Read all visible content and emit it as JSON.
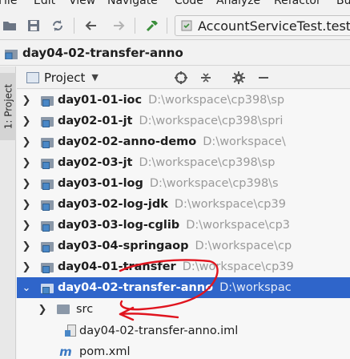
{
  "menu": {
    "items": [
      "File",
      "Edit",
      "View",
      "Navigate",
      "Code",
      "Analyze",
      "Refactor",
      "Build"
    ]
  },
  "toolbar": {
    "run_config": "AccountServiceTest.testTr"
  },
  "navbar": {
    "title": "day04-02-transfer-anno"
  },
  "toolstrip": {
    "label": "1: Project"
  },
  "panel": {
    "title": "Project"
  },
  "tree": {
    "rows": [
      {
        "name": "day01-01-ioc",
        "path": "D:\\workspace\\cp398\\sp"
      },
      {
        "name": "day02-01-jt",
        "path": "D:\\workspace\\cp398\\spri"
      },
      {
        "name": "day02-02-anno-demo",
        "path": "D:\\workspace\\"
      },
      {
        "name": "day02-03-jt",
        "path": "D:\\workspace\\cp398\\sp"
      },
      {
        "name": "day03-01-log",
        "path": "D:\\workspace\\cp398\\s"
      },
      {
        "name": "day03-02-log-jdk",
        "path": "D:\\workspace\\cp39"
      },
      {
        "name": "day03-03-log-cglib",
        "path": "D:\\workspace\\cp3"
      },
      {
        "name": "day03-04-springaop",
        "path": "D:\\workspace\\cp"
      },
      {
        "name": "day04-01-transfer",
        "path": "D:\\workspace\\cp39"
      },
      {
        "name": "day04-02-transfer-anno",
        "path": "D:\\workspac"
      }
    ],
    "children": {
      "src": "src",
      "iml": "day04-02-transfer-anno.iml",
      "pom": "pom.xml",
      "pom_icon": "m"
    }
  },
  "colors": {
    "selection": "#2f65ca",
    "annotation": "#e0141e"
  }
}
